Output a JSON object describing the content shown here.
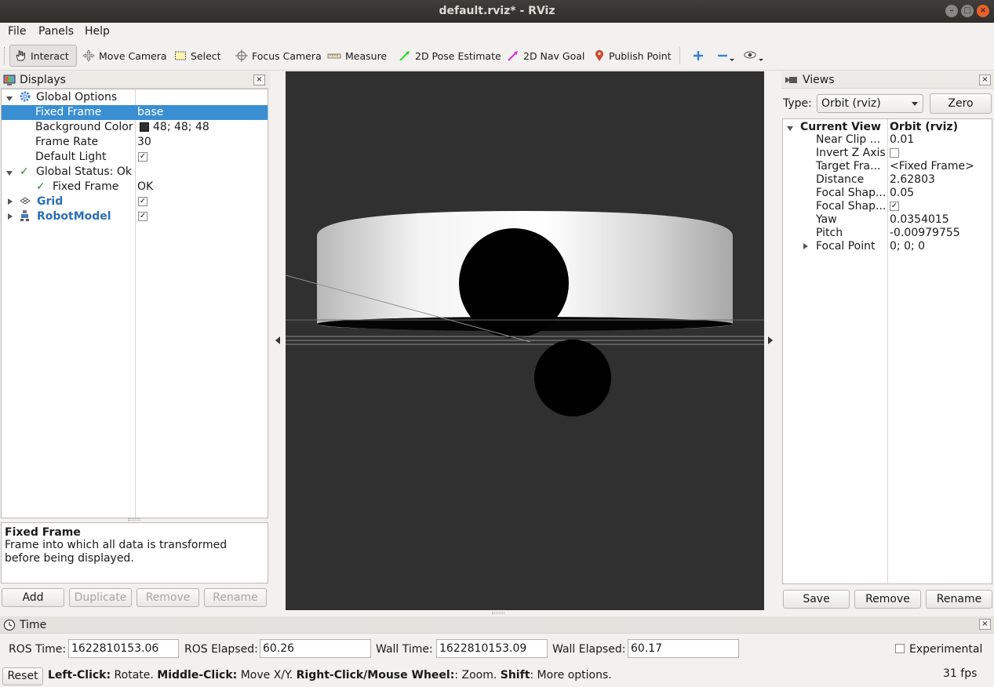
{
  "window": {
    "title": "default.rviz* - RViz"
  },
  "menu": {
    "file": "File",
    "panels": "Panels",
    "help": "Help"
  },
  "toolbar": {
    "interact": "Interact",
    "move_camera": "Move Camera",
    "select": "Select",
    "focus_camera": "Focus Camera",
    "measure": "Measure",
    "pose_estimate": "2D Pose Estimate",
    "nav_goal": "2D Nav Goal",
    "publish_point": "Publish Point"
  },
  "displays": {
    "title": "Displays",
    "global_options": "Global Options",
    "fixed_frame_label": "Fixed Frame",
    "fixed_frame_value": "base",
    "background_color_label": "Background Color",
    "background_color_value": "48; 48; 48",
    "frame_rate_label": "Frame Rate",
    "frame_rate_value": "30",
    "default_light_label": "Default Light",
    "global_status": "Global Status: Ok",
    "status_fixed_frame_label": "Fixed Frame",
    "status_fixed_frame_value": "OK",
    "grid": "Grid",
    "robot_model": "RobotModel",
    "desc_title": "Fixed Frame",
    "desc_text": "Frame into which all data is transformed before being displayed.",
    "buttons": {
      "add": "Add",
      "duplicate": "Duplicate",
      "remove": "Remove",
      "rename": "Rename"
    }
  },
  "views": {
    "title": "Views",
    "type_label": "Type:",
    "type_value": "Orbit (rviz)",
    "zero": "Zero",
    "current_view": "Current View",
    "current_view_value": "Orbit (rviz)",
    "props": [
      {
        "name": "Near Clip ...",
        "value": "0.01"
      },
      {
        "name": "Invert Z Axis",
        "value": ""
      },
      {
        "name": "Target Fra...",
        "value": "<Fixed Frame>"
      },
      {
        "name": "Distance",
        "value": "2.62803"
      },
      {
        "name": "Focal Shap...",
        "value": "0.05"
      },
      {
        "name": "Focal Shap...",
        "value": ""
      },
      {
        "name": "Yaw",
        "value": "0.0354015"
      },
      {
        "name": "Pitch",
        "value": "-0.00979755"
      },
      {
        "name": "Focal Point",
        "value": "0; 0; 0"
      }
    ],
    "buttons": {
      "save": "Save",
      "remove": "Remove",
      "rename": "Rename"
    }
  },
  "time": {
    "title": "Time",
    "ros_time_label": "ROS Time:",
    "ros_time_value": "1622810153.06",
    "ros_elapsed_label": "ROS Elapsed:",
    "ros_elapsed_value": "60.26",
    "wall_time_label": "Wall Time:",
    "wall_time_value": "1622810153.09",
    "wall_elapsed_label": "Wall Elapsed:",
    "wall_elapsed_value": "60.17",
    "experimental": "Experimental"
  },
  "status": {
    "reset": "Reset",
    "left_click": "Left-Click:",
    "left_click_desc": " Rotate. ",
    "middle_click": "Middle-Click:",
    "middle_click_desc": " Move X/Y. ",
    "right_click": "Right-Click/Mouse Wheel:",
    "right_click_desc": ": Zoom. ",
    "shift": "Shift",
    "shift_desc": ": More options.",
    "fps": "31 fps"
  },
  "colors": {
    "viewport_bg": "#303030",
    "selection": "#3a8fd3",
    "link_blue": "#2a6fb8"
  }
}
